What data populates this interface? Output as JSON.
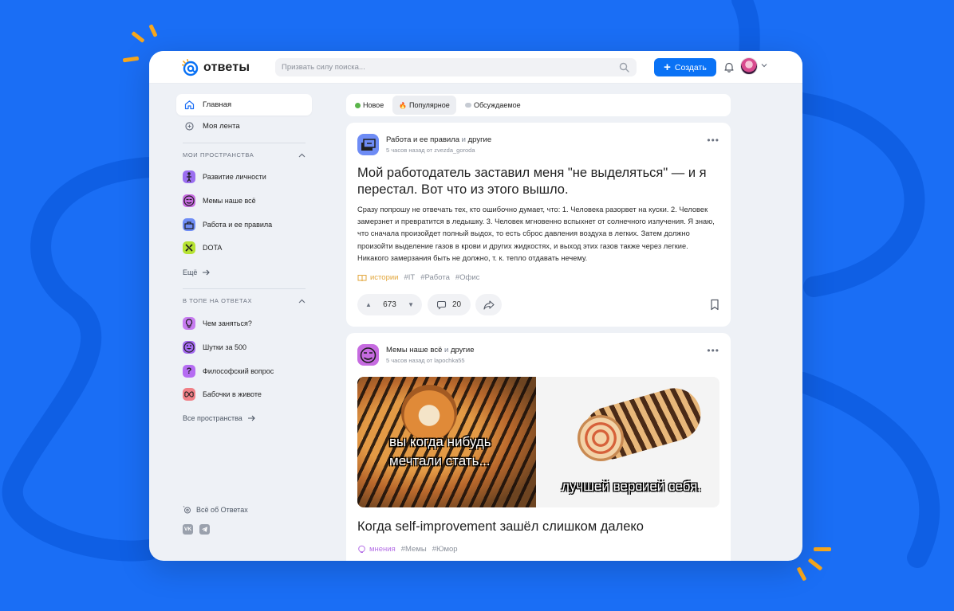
{
  "colors": {
    "background": "#1a6ef5",
    "accent": "#0a72f5",
    "spark": "#f7a71d",
    "category_stories": "#e2a63b",
    "category_opinions": "#b46ee6"
  },
  "header": {
    "logo_text": "ответы",
    "search_placeholder": "Призвать силу поиска...",
    "create_label": "Создать"
  },
  "sidebar": {
    "nav": [
      {
        "label": "Главная",
        "icon": "home-icon"
      },
      {
        "label": "Моя лента",
        "icon": "feed-icon"
      }
    ],
    "my_spaces_title": "Мои пространства",
    "my_spaces": [
      {
        "label": "Развитие личности",
        "icon": "self-development-icon",
        "color": "#9b6ef0"
      },
      {
        "label": "Мемы наше всё",
        "icon": "memes-icon",
        "color": "#c66be0"
      },
      {
        "label": "Работа и ее правила",
        "icon": "work-icon",
        "color": "#6e8cf5"
      },
      {
        "label": "DOTA",
        "icon": "dota-icon",
        "color": "#b6e233"
      }
    ],
    "more_label": "Ещё",
    "top_title": "В топе на Ответах",
    "top_spaces": [
      {
        "label": "Чем заняться?",
        "icon": "lightbulb-icon",
        "color": "#c77cf0"
      },
      {
        "label": "Шутки за 500",
        "icon": "jokes-icon",
        "color": "#a46af0"
      },
      {
        "label": "Философский вопрос",
        "icon": "question-icon",
        "color": "#b56cf2"
      },
      {
        "label": "Бабочки в животе",
        "icon": "butterflies-icon",
        "color": "#f07f86"
      }
    ],
    "all_spaces_label": "Все пространства",
    "about_label": "Всё об Ответах",
    "social": [
      "VK",
      "TG"
    ]
  },
  "tabs": [
    {
      "label": "Новое",
      "icon": "green-dot-icon"
    },
    {
      "label": "Популярное",
      "icon": "fire-icon",
      "active": true
    },
    {
      "label": "Обсуждаемое",
      "icon": "speech-bubble-icon"
    }
  ],
  "posts": [
    {
      "space": "Работа и ее правила",
      "and": "и",
      "others": "другие",
      "meta": "5 часов назад от zvezda_goroda",
      "title": "Мой работодатель заставил меня \"не выделяться\" — и я перестал. Вот что из этого вышло.",
      "body": "Сразу попрошу не отвечать тех, кто ошибочно думает, что: 1. Человека разорвет на куски. 2. Человек замерзнет и превратится в ледышку. 3. Человек мгновенно вспыхнет от солнечного излучения. Я знаю, что сначала произойдет полный выдох, то есть сброс давления воздуха в легких. Затем должно произойти выделение газов в крови и других жидкостях, и выход этих газов также через легкие. Никакого замерзания быть не должно, т. к. тепло отдавать нечему.",
      "category": "истории",
      "tags": [
        "#IT",
        "#Работа",
        "#Офис"
      ],
      "votes": "673",
      "comments": "20"
    },
    {
      "space": "Мемы наше всё",
      "and": "и",
      "others": "другие",
      "meta": "5 часов назад от lapochka55",
      "meme_left_text_1": "вы когда нибудь",
      "meme_left_text_2": "мечтали стать...",
      "meme_right_text": "лучшей версией себя.",
      "title": "Когда self-improvement зашёл слишком далеко",
      "category": "мнения",
      "tags": [
        "#Мемы",
        "#Юмор"
      ]
    }
  ]
}
